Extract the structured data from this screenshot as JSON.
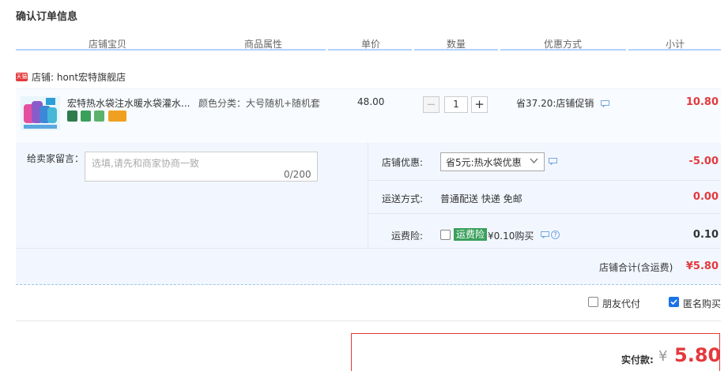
{
  "page_title": "确认订单信息",
  "columns": [
    "店铺宝贝",
    "商品属性",
    "单价",
    "数量",
    "优惠方式",
    "小计"
  ],
  "shop": {
    "icon": "tmall-shop-icon",
    "label": "店铺:",
    "name": "hont宏特旗舰店"
  },
  "item": {
    "name": "宏特热水袋注水暖水袋灌水...",
    "attribute": "颜色分类：大号随机+随机套",
    "price": "48.00",
    "quantity": "1",
    "minus": "−",
    "plus": "+",
    "promo": "省37.20:店铺促销",
    "subtotal": "10.80",
    "badges": [
      "#2d7c4a",
      "#3aa05c",
      "#5bb36b",
      "#f0a020"
    ]
  },
  "memo": {
    "label": "给卖家留言：",
    "placeholder": "选填,请先和商家协商一致",
    "counter": "0/200"
  },
  "shop_discount": {
    "label": "店铺优惠:",
    "selected": "省5元:热水袋优惠",
    "amount": "-5.00"
  },
  "shipping": {
    "label": "运送方式:",
    "method": "普通配送 快递 免邮",
    "amount": "0.00"
  },
  "freight_insurance": {
    "label": "运费险:",
    "tag": "运费险",
    "text": "¥0.10购买",
    "help": "?",
    "amount": "0.10"
  },
  "shop_total": {
    "label": "店铺合计(含运费)",
    "amount": "¥5.80"
  },
  "options": {
    "friend_pay": "朋友代付",
    "anonymous": "匿名购买"
  },
  "payment": {
    "label": "实付款:",
    "currency": "¥",
    "amount": "5.80"
  }
}
